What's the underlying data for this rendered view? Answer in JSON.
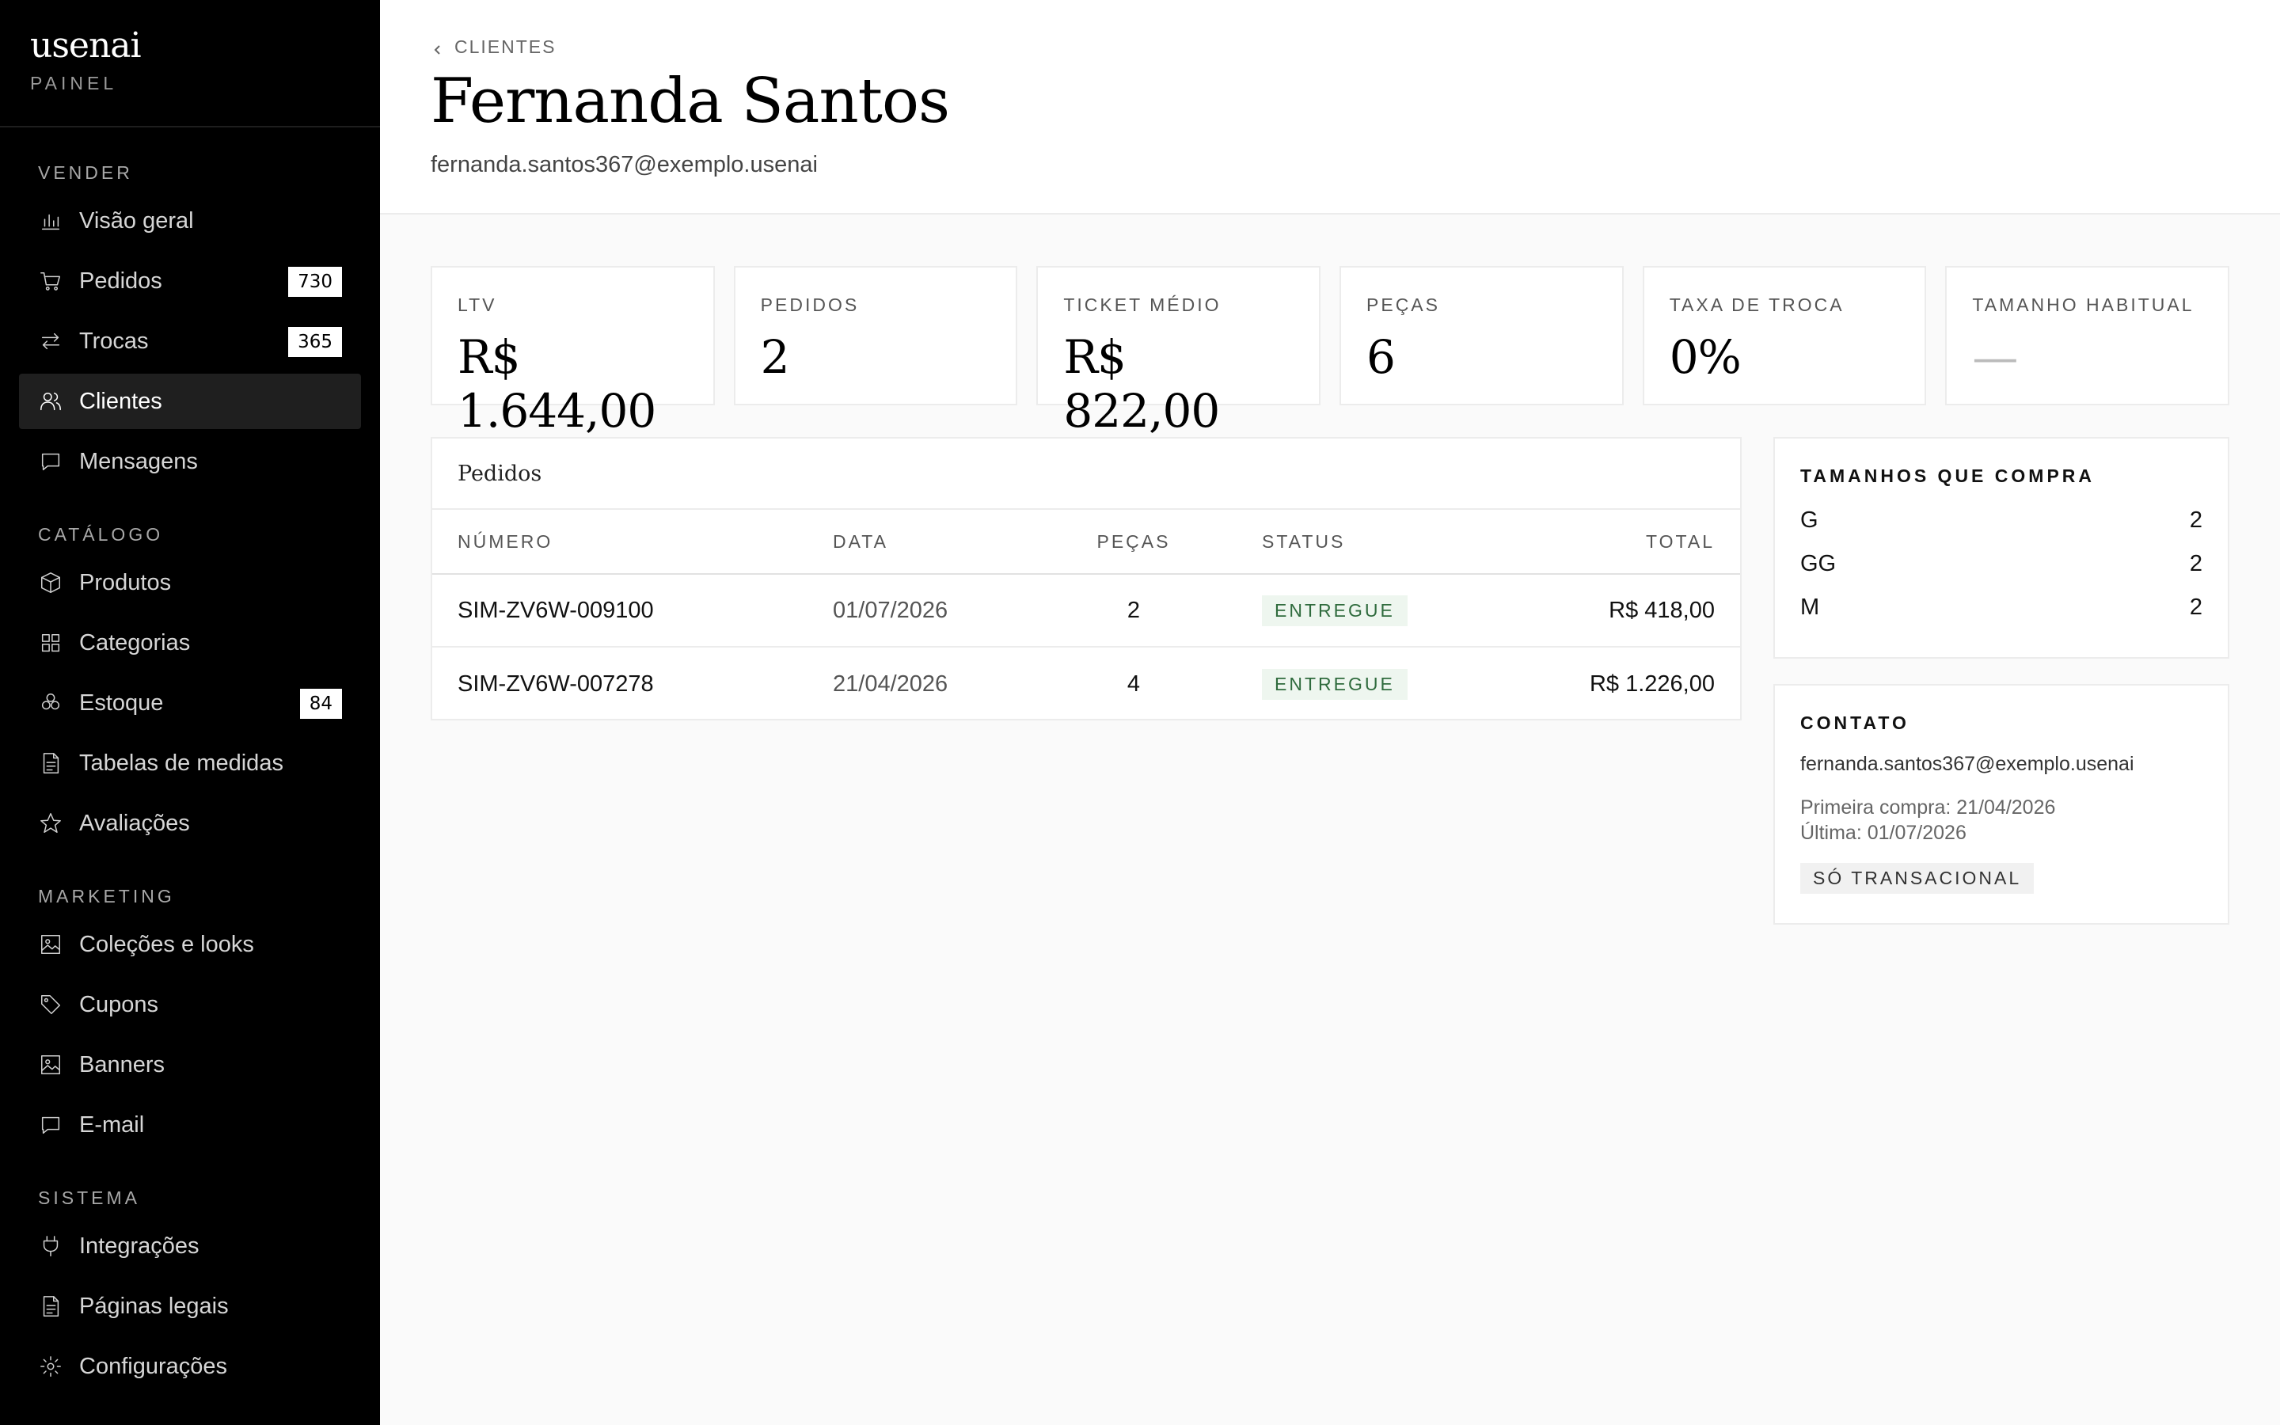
{
  "brand": {
    "logo": "usenai",
    "subtitle": "PAINEL"
  },
  "sidebar": {
    "sections": [
      {
        "heading": "VENDER",
        "items": [
          {
            "label": "Visão geral",
            "icon": "bar-chart-icon"
          },
          {
            "label": "Pedidos",
            "icon": "cart-icon",
            "badge": "730"
          },
          {
            "label": "Trocas",
            "icon": "exchange-icon",
            "badge": "365"
          },
          {
            "label": "Clientes",
            "icon": "users-icon",
            "active": true
          },
          {
            "label": "Mensagens",
            "icon": "message-icon"
          }
        ]
      },
      {
        "heading": "CATÁLOGO",
        "items": [
          {
            "label": "Produtos",
            "icon": "box-icon"
          },
          {
            "label": "Categorias",
            "icon": "grid-icon"
          },
          {
            "label": "Estoque",
            "icon": "stack-icon",
            "badge": "84"
          },
          {
            "label": "Tabelas de medidas",
            "icon": "document-icon"
          },
          {
            "label": "Avaliações",
            "icon": "star-icon"
          }
        ]
      },
      {
        "heading": "MARKETING",
        "items": [
          {
            "label": "Coleções e looks",
            "icon": "image-icon"
          },
          {
            "label": "Cupons",
            "icon": "tag-icon"
          },
          {
            "label": "Banners",
            "icon": "image-icon"
          },
          {
            "label": "E-mail",
            "icon": "message-icon"
          }
        ]
      },
      {
        "heading": "SISTEMA",
        "items": [
          {
            "label": "Integrações",
            "icon": "plug-icon"
          },
          {
            "label": "Páginas legais",
            "icon": "document-icon"
          },
          {
            "label": "Configurações",
            "icon": "gear-icon"
          }
        ]
      }
    ]
  },
  "header": {
    "breadcrumb": "CLIENTES",
    "title": "Fernanda Santos",
    "email": "fernanda.santos367@exemplo.usenai"
  },
  "stats": [
    {
      "label": "LTV",
      "value": "R$ 1.644,00"
    },
    {
      "label": "PEDIDOS",
      "value": "2"
    },
    {
      "label": "TICKET MÉDIO",
      "value": "R$ 822,00"
    },
    {
      "label": "PEÇAS",
      "value": "6"
    },
    {
      "label": "TAXA DE TROCA",
      "value": "0%"
    },
    {
      "label": "TAMANHO HABITUAL",
      "value": "—"
    }
  ],
  "orders": {
    "title": "Pedidos",
    "columns": {
      "number": "NÚMERO",
      "date": "DATA",
      "qty": "PEÇAS",
      "status": "STATUS",
      "total": "TOTAL"
    },
    "rows": [
      {
        "number": "SIM-ZV6W-009100",
        "date": "01/07/2026",
        "qty": "2",
        "status": "ENTREGUE",
        "total": "R$ 418,00"
      },
      {
        "number": "SIM-ZV6W-007278",
        "date": "21/04/2026",
        "qty": "4",
        "status": "ENTREGUE",
        "total": "R$ 1.226,00"
      }
    ]
  },
  "sizes_panel": {
    "title": "TAMANHOS QUE COMPRA",
    "sizes": [
      {
        "size": "G",
        "count": "2"
      },
      {
        "size": "GG",
        "count": "2"
      },
      {
        "size": "M",
        "count": "2"
      }
    ]
  },
  "contact_panel": {
    "title": "CONTATO",
    "email": "fernanda.santos367@exemplo.usenai",
    "first_purchase": "Primeira compra: 21/04/2026",
    "last_purchase": "Última: 01/07/2026",
    "tag": "SÓ TRANSACIONAL"
  },
  "colors": {
    "sidebar_bg": "#000000",
    "status_green": "#2f6b3d",
    "status_green_bg": "#eef6ef"
  }
}
